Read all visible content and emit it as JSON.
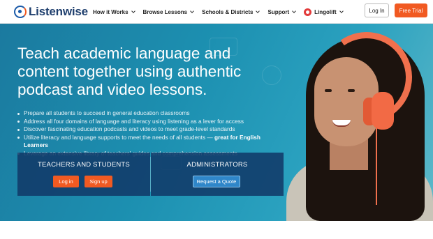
{
  "header": {
    "logo_text": "Listenwise",
    "nav": [
      {
        "label": "How it Works"
      },
      {
        "label": "Browse Lessons"
      },
      {
        "label": "Schools & Districts"
      },
      {
        "label": "Support"
      },
      {
        "label": "Lingolift"
      }
    ],
    "login_label": "Log In",
    "trial_label": "Free Trial"
  },
  "hero": {
    "headline": "Teach academic language and content together using authentic podcast and video lessons.",
    "bullets": [
      "Prepare all students to succeed in general education classrooms",
      "Address all four domains of language and literacy using listening as a lever for access",
      "Discover fascinating education podcasts and videos to meet grade-level standards",
      "Leverage an extensive library of teachers' guides and comprehension assessments"
    ],
    "bullet_special": {
      "text": "Utilize literacy and language supports to meet the needs of all students — ",
      "strong": "great for English Learners"
    }
  },
  "panels": {
    "teachers": {
      "title": "TEACHERS AND STUDENTS",
      "login_label": "Log in",
      "signup_label": "Sign up"
    },
    "admins": {
      "title": "ADMINISTRATORS",
      "quote_label": "Request a Quote"
    }
  },
  "colors": {
    "brand_orange": "#f15a22",
    "brand_navy": "#1f3f6e",
    "hero_teal": "#1c8fb0",
    "panel_navy": "#113a69",
    "quote_blue": "#2f86c9"
  },
  "icons": [
    "logo-mark-icon",
    "chevron-down-icon",
    "lingolift-icon"
  ]
}
